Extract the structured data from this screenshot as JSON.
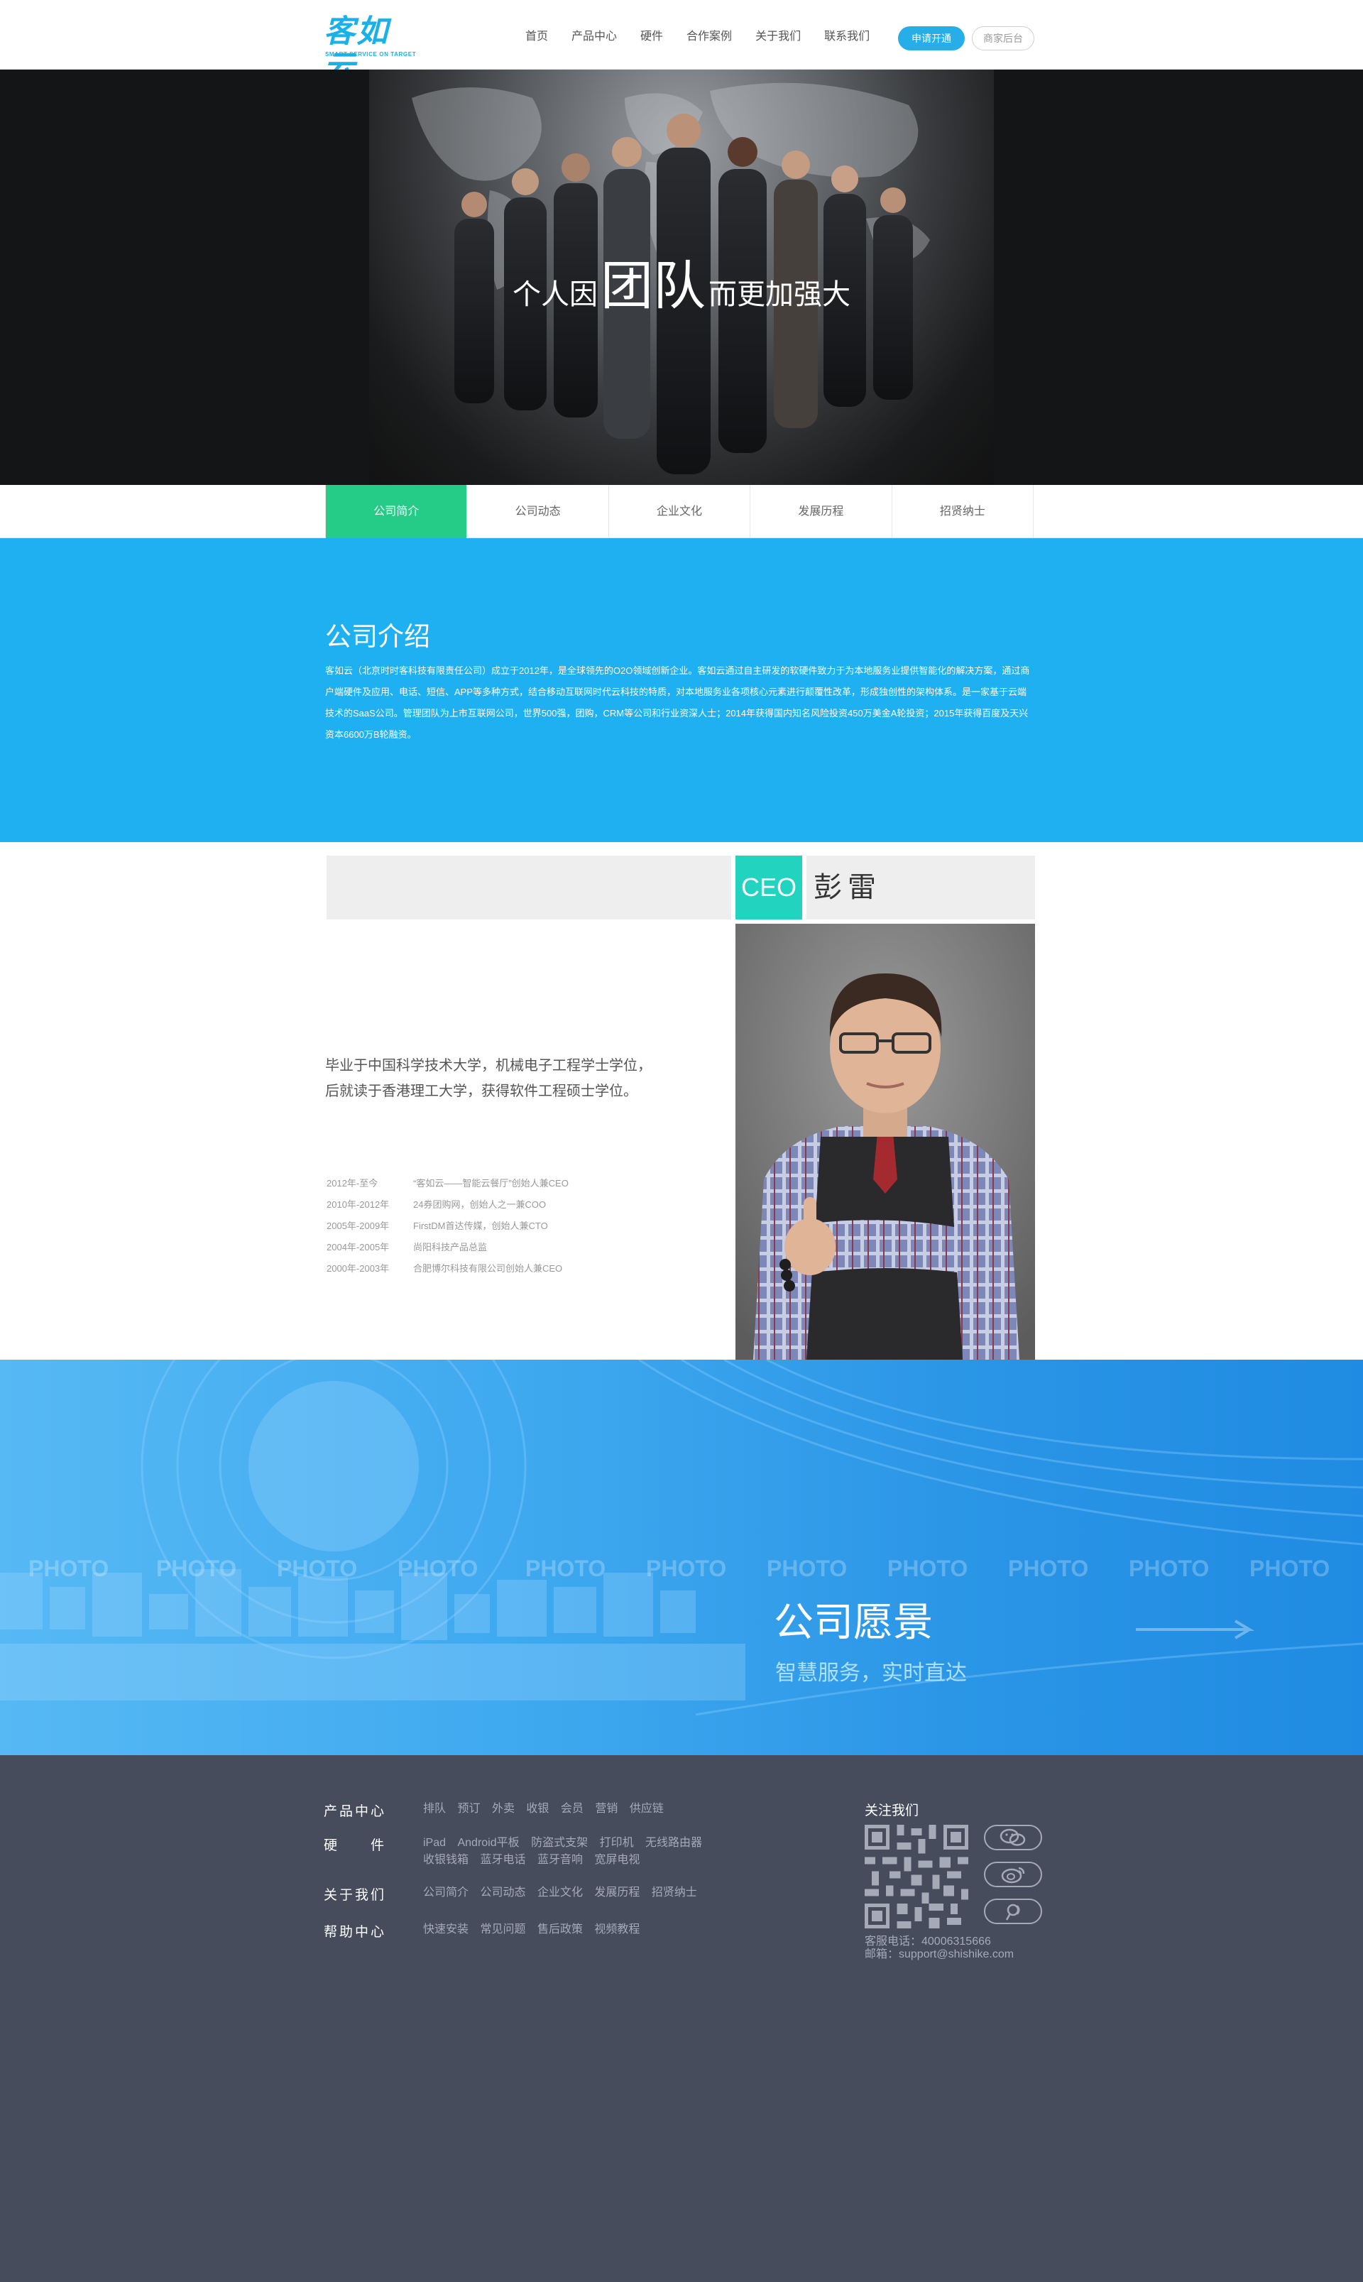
{
  "header": {
    "logo_text": "客如云",
    "logo_sub": "SMART SERVICE ON TARGET",
    "nav": [
      "首页",
      "产品中心",
      "硬件",
      "合作案例",
      "关于我们",
      "联系我们"
    ],
    "apply_label": "申请开通",
    "merchant_label": "商家后台"
  },
  "hero": {
    "title_pre": "个人因",
    "title_em": "团队",
    "title_post": "而更加强大"
  },
  "tabs": [
    "公司简介",
    "公司动态",
    "企业文化",
    "发展历程",
    "招贤纳士"
  ],
  "intro": {
    "title": "公司介绍",
    "text": "客如云（北京时时客科技有限责任公司）成立于2012年，是全球领先的O2O领域创新企业。客如云通过自主研发的软硬件致力于为本地服务业提供智能化的解决方案，通过商户端硬件及应用、电话、短信、APP等多种方式，结合移动互联网时代云科技的特质，对本地服务业各项核心元素进行颠覆性改革，形成独创性的架构体系。是一家基于云端技术的SaaS公司。管理团队为上市互联网公司，世界500强，团购，CRM等公司和行业资深人士；2014年获得国内知名风险投资450万美金A轮投资；2015年获得百度及天兴资本6600万B轮融资。"
  },
  "ceo": {
    "tag": "CEO",
    "name": "彭雷",
    "desc_line1": "毕业于中国科学技术大学，机械电子工程学士学位，",
    "desc_line2": "后就读于香港理工大学，获得软件工程硕士学位。",
    "timeline": [
      {
        "date": "2012年-至今",
        "text": "“客如云——智能云餐厅”创始人兼CEO"
      },
      {
        "date": "2010年-2012年",
        "text": "24券团购网，创始人之一兼COO"
      },
      {
        "date": "2005年-2009年",
        "text": "FirstDM首达传媒，创始人兼CTO"
      },
      {
        "date": "2004年-2005年",
        "text": "尚阳科技产品总监"
      },
      {
        "date": "2000年-2003年",
        "text": "合肥博尔科技有限公司创始人兼CEO"
      }
    ]
  },
  "vision": {
    "title": "公司愿景",
    "subtitle": "智慧服务，实时直达",
    "watermark": "PHOTO"
  },
  "footer": {
    "rows": [
      {
        "head": "产品中心",
        "links": [
          "排队",
          "预订",
          "外卖",
          "收银",
          "会员",
          "营销",
          "供应链"
        ]
      },
      {
        "head": "硬　　件",
        "links": [
          "iPad",
          "Android平板",
          "防盗式支架",
          "打印机",
          "无线路由器",
          "收银钱箱",
          "蓝牙电话",
          "蓝牙音响",
          "宽屏电视"
        ]
      },
      {
        "head": "关于我们",
        "links": [
          "公司简介",
          "公司动态",
          "企业文化",
          "发展历程",
          "招贤纳士"
        ]
      },
      {
        "head": "帮助中心",
        "links": [
          "快速安装",
          "常见问题",
          "售后政策",
          "视频教程"
        ]
      }
    ],
    "follow_title": "关注我们",
    "phone": "客服电话：40006315666",
    "email": "邮箱：support@shishike.com"
  },
  "colors": {
    "brand": "#1ab0e8",
    "tab_active": "#25cc88",
    "intro_bg": "#1fb0f2",
    "ceo_tag": "#22d3bf",
    "footer_bg": "#464c5c"
  }
}
